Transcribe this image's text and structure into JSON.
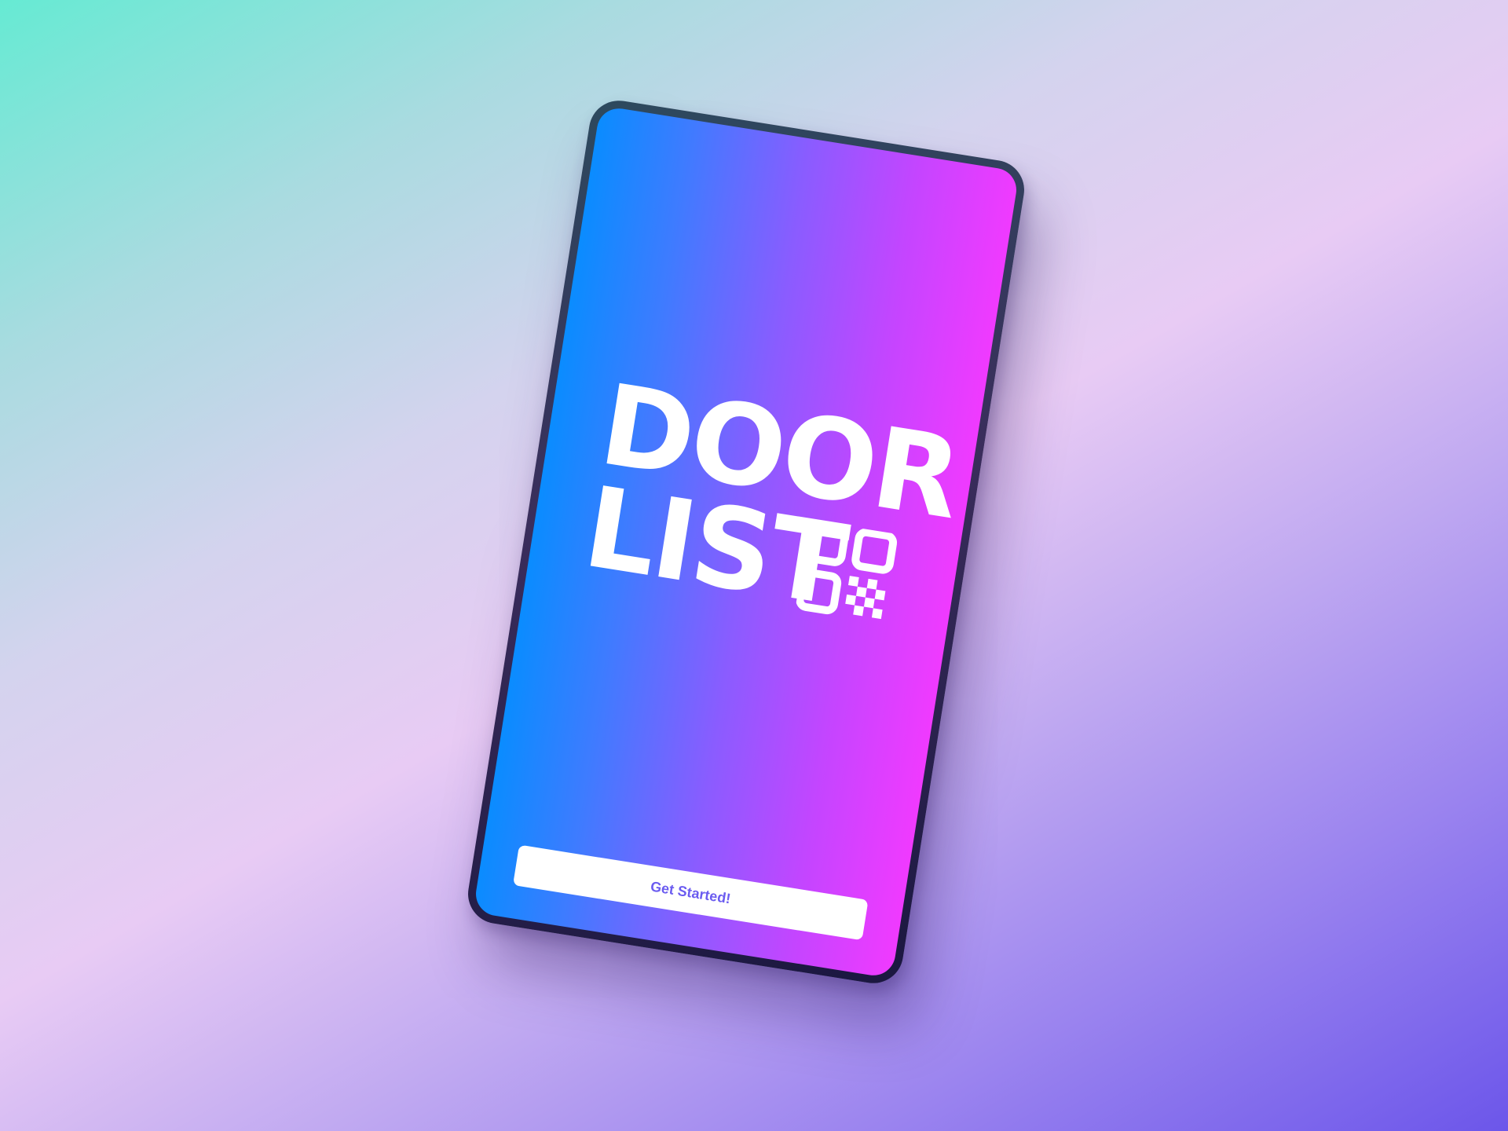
{
  "app": {
    "logo_line_1": "DOOR",
    "logo_line_2": "LIST",
    "logo_mark_icon": "qr-code-icon"
  },
  "actions": {
    "get_started_label": "Get Started!"
  },
  "colors": {
    "screen_gradient_start": "#0a8cff",
    "screen_gradient_end": "#f03aff",
    "button_text": "#6b5cf0",
    "button_background": "#ffffff"
  }
}
